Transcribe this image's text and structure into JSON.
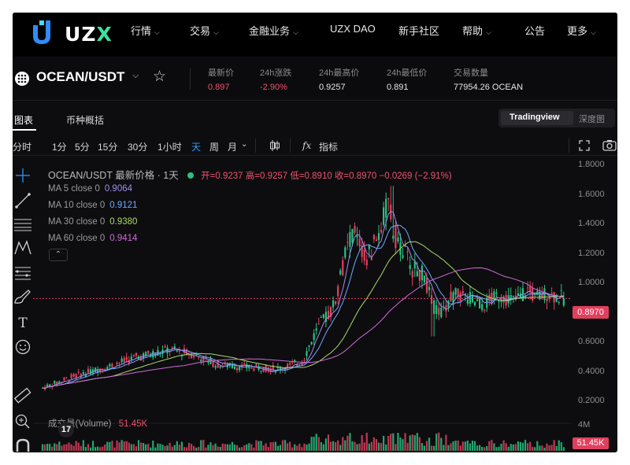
{
  "brand": {
    "name_u": "U",
    "name_zx": "ZX",
    "name_x": "X"
  },
  "nav": {
    "items": [
      {
        "label": "行情",
        "chevron": true
      },
      {
        "label": "交易",
        "chevron": true
      },
      {
        "label": "金融业务",
        "chevron": true
      },
      {
        "label": "UZX DAO",
        "chevron": false
      },
      {
        "label": "新手社区",
        "chevron": false
      },
      {
        "label": "帮助",
        "chevron": true
      },
      {
        "label": "公告",
        "chevron": false
      },
      {
        "label": "更多",
        "chevron": true
      }
    ]
  },
  "ticker": {
    "pair": "OCEAN/USDT",
    "stats": [
      {
        "label": "最新价",
        "value": "0.897",
        "red": true
      },
      {
        "label": "24h涨跌",
        "value": "-2.90%",
        "red": true
      },
      {
        "label": "24h最高价",
        "value": "0.9257",
        "red": false
      },
      {
        "label": "24h最低价",
        "value": "0.891",
        "red": false
      },
      {
        "label": "交易数量",
        "value": "77954.26 OCEAN",
        "red": false
      }
    ]
  },
  "tabs": {
    "chart": "图表",
    "overview": "币种概括",
    "tradingview": "Tradingview",
    "depth": "深度图"
  },
  "toolbar": {
    "intervals": [
      "分时",
      "1分",
      "5分",
      "15分",
      "30分",
      "1小时",
      "天",
      "周",
      "月"
    ],
    "active_interval": "天",
    "indicators": "指标",
    "fx": "fx"
  },
  "chart_legend": {
    "title": "OCEAN/USDT 最新价格 · 1天",
    "ohlc": "开=0.9237 高=0.9257 低=0.8910 收=0.8970 −0.0269 (−2.91%)",
    "ma": [
      {
        "label": "MA 5 close 0",
        "value": "0.9064",
        "color": "#9f8cf0"
      },
      {
        "label": "MA 10 close 0",
        "value": "0.9121",
        "color": "#6fa8ff"
      },
      {
        "label": "MA 30 close 0",
        "value": "0.9380",
        "color": "#a8d86a"
      },
      {
        "label": "MA 60 close 0",
        "value": "0.9414",
        "color": "#d06ad8"
      }
    ],
    "volume_label": "成交量(Volume)",
    "volume_value": "51.45K"
  },
  "chart_data": {
    "type": "candlestick",
    "y_ticks": [
      "1.8000",
      "1.6000",
      "1.4000",
      "1.2000",
      "1.0000",
      "0.8000",
      "0.6000",
      "0.4000",
      "0.2000"
    ],
    "ylim": [
      0.2,
      1.8
    ],
    "current_price": "0.8970",
    "volume_tick": "4M",
    "volume_current": "51.45K",
    "colors": {
      "up": "#26c281",
      "down": "#e0405e"
    }
  }
}
